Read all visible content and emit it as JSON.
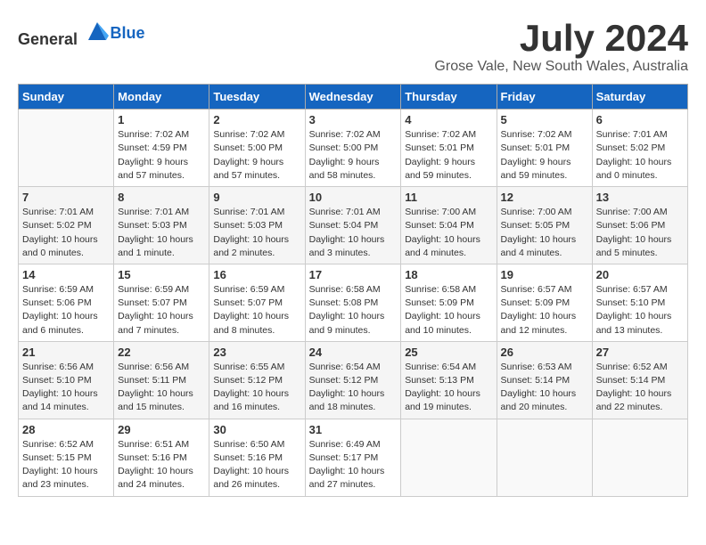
{
  "header": {
    "logo_general": "General",
    "logo_blue": "Blue",
    "month": "July 2024",
    "location": "Grose Vale, New South Wales, Australia"
  },
  "days_of_week": [
    "Sunday",
    "Monday",
    "Tuesday",
    "Wednesday",
    "Thursday",
    "Friday",
    "Saturday"
  ],
  "weeks": [
    [
      {
        "day": "",
        "sunrise": "",
        "sunset": "",
        "daylight": ""
      },
      {
        "day": "1",
        "sunrise": "Sunrise: 7:02 AM",
        "sunset": "Sunset: 4:59 PM",
        "daylight": "Daylight: 9 hours and 57 minutes."
      },
      {
        "day": "2",
        "sunrise": "Sunrise: 7:02 AM",
        "sunset": "Sunset: 5:00 PM",
        "daylight": "Daylight: 9 hours and 57 minutes."
      },
      {
        "day": "3",
        "sunrise": "Sunrise: 7:02 AM",
        "sunset": "Sunset: 5:00 PM",
        "daylight": "Daylight: 9 hours and 58 minutes."
      },
      {
        "day": "4",
        "sunrise": "Sunrise: 7:02 AM",
        "sunset": "Sunset: 5:01 PM",
        "daylight": "Daylight: 9 hours and 59 minutes."
      },
      {
        "day": "5",
        "sunrise": "Sunrise: 7:02 AM",
        "sunset": "Sunset: 5:01 PM",
        "daylight": "Daylight: 9 hours and 59 minutes."
      },
      {
        "day": "6",
        "sunrise": "Sunrise: 7:01 AM",
        "sunset": "Sunset: 5:02 PM",
        "daylight": "Daylight: 10 hours and 0 minutes."
      }
    ],
    [
      {
        "day": "7",
        "sunrise": "Sunrise: 7:01 AM",
        "sunset": "Sunset: 5:02 PM",
        "daylight": "Daylight: 10 hours and 0 minutes."
      },
      {
        "day": "8",
        "sunrise": "Sunrise: 7:01 AM",
        "sunset": "Sunset: 5:03 PM",
        "daylight": "Daylight: 10 hours and 1 minute."
      },
      {
        "day": "9",
        "sunrise": "Sunrise: 7:01 AM",
        "sunset": "Sunset: 5:03 PM",
        "daylight": "Daylight: 10 hours and 2 minutes."
      },
      {
        "day": "10",
        "sunrise": "Sunrise: 7:01 AM",
        "sunset": "Sunset: 5:04 PM",
        "daylight": "Daylight: 10 hours and 3 minutes."
      },
      {
        "day": "11",
        "sunrise": "Sunrise: 7:00 AM",
        "sunset": "Sunset: 5:04 PM",
        "daylight": "Daylight: 10 hours and 4 minutes."
      },
      {
        "day": "12",
        "sunrise": "Sunrise: 7:00 AM",
        "sunset": "Sunset: 5:05 PM",
        "daylight": "Daylight: 10 hours and 4 minutes."
      },
      {
        "day": "13",
        "sunrise": "Sunrise: 7:00 AM",
        "sunset": "Sunset: 5:06 PM",
        "daylight": "Daylight: 10 hours and 5 minutes."
      }
    ],
    [
      {
        "day": "14",
        "sunrise": "Sunrise: 6:59 AM",
        "sunset": "Sunset: 5:06 PM",
        "daylight": "Daylight: 10 hours and 6 minutes."
      },
      {
        "day": "15",
        "sunrise": "Sunrise: 6:59 AM",
        "sunset": "Sunset: 5:07 PM",
        "daylight": "Daylight: 10 hours and 7 minutes."
      },
      {
        "day": "16",
        "sunrise": "Sunrise: 6:59 AM",
        "sunset": "Sunset: 5:07 PM",
        "daylight": "Daylight: 10 hours and 8 minutes."
      },
      {
        "day": "17",
        "sunrise": "Sunrise: 6:58 AM",
        "sunset": "Sunset: 5:08 PM",
        "daylight": "Daylight: 10 hours and 9 minutes."
      },
      {
        "day": "18",
        "sunrise": "Sunrise: 6:58 AM",
        "sunset": "Sunset: 5:09 PM",
        "daylight": "Daylight: 10 hours and 10 minutes."
      },
      {
        "day": "19",
        "sunrise": "Sunrise: 6:57 AM",
        "sunset": "Sunset: 5:09 PM",
        "daylight": "Daylight: 10 hours and 12 minutes."
      },
      {
        "day": "20",
        "sunrise": "Sunrise: 6:57 AM",
        "sunset": "Sunset: 5:10 PM",
        "daylight": "Daylight: 10 hours and 13 minutes."
      }
    ],
    [
      {
        "day": "21",
        "sunrise": "Sunrise: 6:56 AM",
        "sunset": "Sunset: 5:10 PM",
        "daylight": "Daylight: 10 hours and 14 minutes."
      },
      {
        "day": "22",
        "sunrise": "Sunrise: 6:56 AM",
        "sunset": "Sunset: 5:11 PM",
        "daylight": "Daylight: 10 hours and 15 minutes."
      },
      {
        "day": "23",
        "sunrise": "Sunrise: 6:55 AM",
        "sunset": "Sunset: 5:12 PM",
        "daylight": "Daylight: 10 hours and 16 minutes."
      },
      {
        "day": "24",
        "sunrise": "Sunrise: 6:54 AM",
        "sunset": "Sunset: 5:12 PM",
        "daylight": "Daylight: 10 hours and 18 minutes."
      },
      {
        "day": "25",
        "sunrise": "Sunrise: 6:54 AM",
        "sunset": "Sunset: 5:13 PM",
        "daylight": "Daylight: 10 hours and 19 minutes."
      },
      {
        "day": "26",
        "sunrise": "Sunrise: 6:53 AM",
        "sunset": "Sunset: 5:14 PM",
        "daylight": "Daylight: 10 hours and 20 minutes."
      },
      {
        "day": "27",
        "sunrise": "Sunrise: 6:52 AM",
        "sunset": "Sunset: 5:14 PM",
        "daylight": "Daylight: 10 hours and 22 minutes."
      }
    ],
    [
      {
        "day": "28",
        "sunrise": "Sunrise: 6:52 AM",
        "sunset": "Sunset: 5:15 PM",
        "daylight": "Daylight: 10 hours and 23 minutes."
      },
      {
        "day": "29",
        "sunrise": "Sunrise: 6:51 AM",
        "sunset": "Sunset: 5:16 PM",
        "daylight": "Daylight: 10 hours and 24 minutes."
      },
      {
        "day": "30",
        "sunrise": "Sunrise: 6:50 AM",
        "sunset": "Sunset: 5:16 PM",
        "daylight": "Daylight: 10 hours and 26 minutes."
      },
      {
        "day": "31",
        "sunrise": "Sunrise: 6:49 AM",
        "sunset": "Sunset: 5:17 PM",
        "daylight": "Daylight: 10 hours and 27 minutes."
      },
      {
        "day": "",
        "sunrise": "",
        "sunset": "",
        "daylight": ""
      },
      {
        "day": "",
        "sunrise": "",
        "sunset": "",
        "daylight": ""
      },
      {
        "day": "",
        "sunrise": "",
        "sunset": "",
        "daylight": ""
      }
    ]
  ]
}
